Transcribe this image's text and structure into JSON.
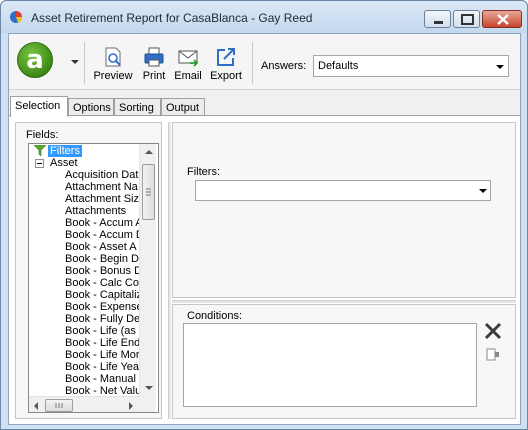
{
  "window": {
    "title": "Asset Retirement Report for CasaBlanca - Gay Reed",
    "app_icon": "pie-chart-icon",
    "controls": [
      "minimize-icon",
      "maximize-icon",
      "close-icon"
    ]
  },
  "toolbar": {
    "logo_letter": "a",
    "buttons": [
      {
        "label": "Preview",
        "icon": "preview-icon"
      },
      {
        "label": "Print",
        "icon": "printer-icon"
      },
      {
        "label": "Email",
        "icon": "email-icon"
      },
      {
        "label": "Export",
        "icon": "export-icon"
      }
    ],
    "answers_label": "Answers:",
    "answers_value": "Defaults"
  },
  "tabs": [
    {
      "label": "Selection",
      "active": true
    },
    {
      "label": "Options",
      "active": false
    },
    {
      "label": "Sorting",
      "active": false
    },
    {
      "label": "Output",
      "active": false
    }
  ],
  "fields": {
    "label": "Fields:",
    "root": "Filters",
    "group": "Asset",
    "items": [
      "Acquisition Dat",
      "Attachment Na",
      "Attachment Siz",
      "Attachments",
      "Book - Accum A",
      "Book - Accum D",
      "Book - Asset A",
      "Book - Begin D",
      "Book - Bonus D",
      "Book - Calc Cor",
      "Book - Capitaliz",
      "Book - Expense",
      "Book - Fully De",
      "Book - Life (as",
      "Book - Life End",
      "Book - Life Mor",
      "Book - Life Yea",
      "Book - Manual",
      "Book - Net Valu"
    ]
  },
  "filters": {
    "label": "Filters:",
    "value": ""
  },
  "conditions": {
    "label": "Conditions:",
    "delete_icon": "delete-x-icon",
    "edit_icon": "edit-condition-icon"
  },
  "colors": {
    "accent_green": "#4a9a1f",
    "selection_blue": "#3399ff",
    "title_bar": "#cfe0f2"
  }
}
